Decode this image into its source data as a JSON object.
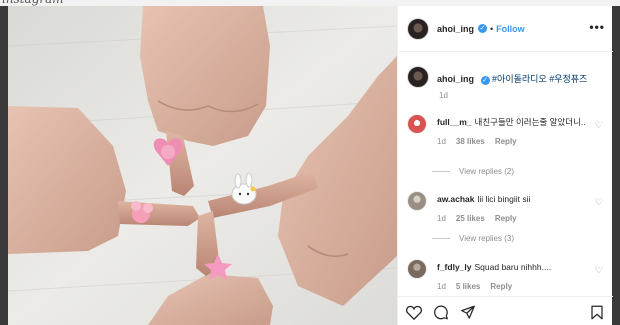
{
  "page_top_text": "instagram",
  "post": {
    "username": "ahoi_ing",
    "follow_label": "Follow",
    "dot": "•",
    "more": "•••",
    "verified_mark": "✓",
    "caption": {
      "username": "ahoi_ing",
      "hashtags": "#아이돌라디오 #우정퓨즈",
      "time": "1d"
    }
  },
  "comments": [
    {
      "username": "full__m_",
      "text": "내친구들만 이러는줄 알았더니..",
      "time": "1d",
      "likes": "38 likes",
      "reply": "Reply",
      "view_replies": "View replies (2)",
      "avatar_color": "#d9534f"
    },
    {
      "username": "aw.achak",
      "text": "lii lici bingiit sii",
      "time": "1d",
      "likes": "25 likes",
      "reply": "Reply",
      "view_replies": "View replies (3)",
      "avatar_color": "#9a8f84"
    },
    {
      "username": "f_fdly_ly",
      "text": "Squad baru nihhh....",
      "time": "1d",
      "likes": "5 likes",
      "reply": "Reply",
      "avatar_color": "#7a6a5e"
    }
  ],
  "icons": [
    "heart-icon",
    "comment-icon",
    "share-icon",
    "bookmark-icon",
    "verified-icon",
    "more-icon"
  ],
  "colors": {
    "accent": "#3897f0",
    "text": "#262626",
    "muted": "#8e8e8e",
    "hashtag": "#003569"
  }
}
